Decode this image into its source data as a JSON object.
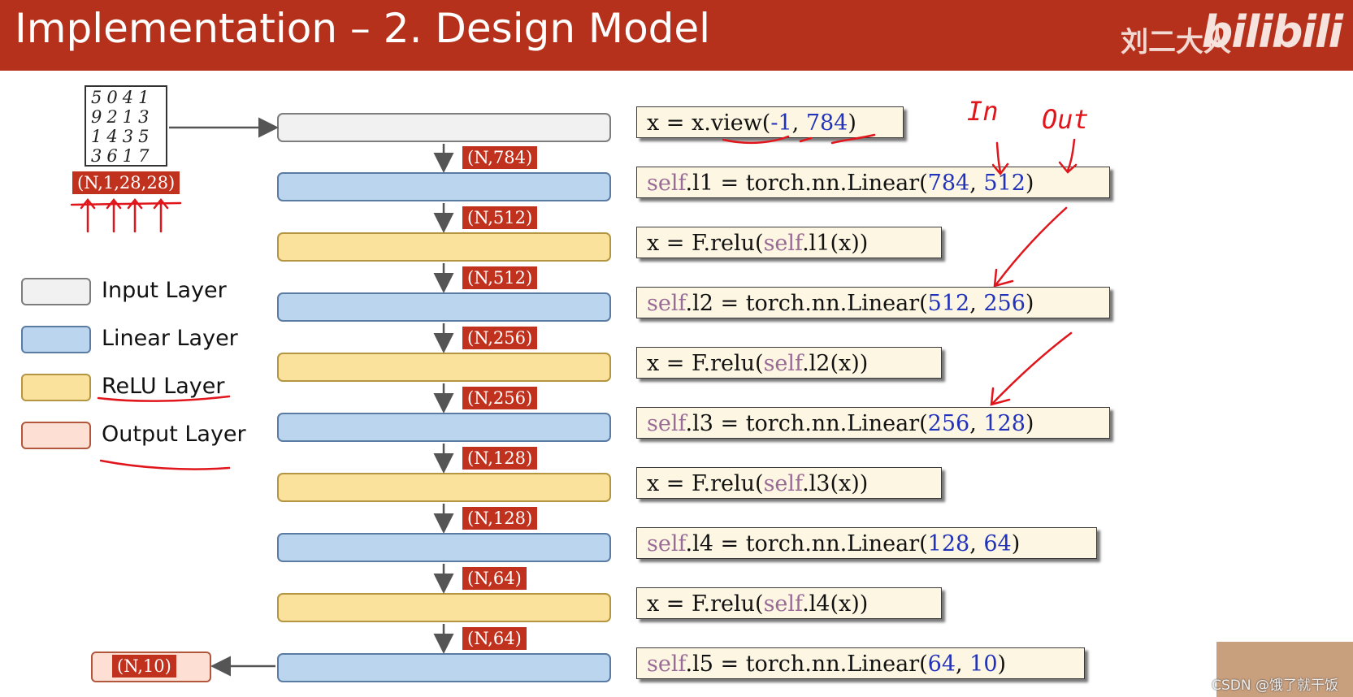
{
  "header": {
    "title": "Implementation – 2. Design Model",
    "brand": "刘二大人",
    "logo": "bilibili"
  },
  "input_image": {
    "digit_rows": [
      "5041",
      "9213",
      "1435",
      "3617"
    ],
    "shape_label": "(N,1,28,28)"
  },
  "legend": {
    "items": [
      {
        "label": "Input Layer",
        "color": "#f1f1f1"
      },
      {
        "label": "Linear Layer",
        "color": "#bcd5ee"
      },
      {
        "label": "ReLU Layer",
        "color": "#fbe29c"
      },
      {
        "label": "Output Layer",
        "color": "#fde0d3"
      }
    ]
  },
  "layers": [
    {
      "type": "input"
    },
    {
      "type": "linear"
    },
    {
      "type": "relu"
    },
    {
      "type": "linear"
    },
    {
      "type": "relu"
    },
    {
      "type": "linear"
    },
    {
      "type": "relu"
    },
    {
      "type": "linear"
    },
    {
      "type": "relu"
    },
    {
      "type": "linear"
    }
  ],
  "shapes": [
    "(N,784)",
    "(N,512)",
    "(N,512)",
    "(N,256)",
    "(N,256)",
    "(N,128)",
    "(N,128)",
    "(N,64)",
    "(N,64)"
  ],
  "output": {
    "label": "(N,10)"
  },
  "code": {
    "c1": {
      "a": "x = x.view(",
      "b": "-1",
      "c": ", ",
      "d": "784",
      "e": ")"
    },
    "c2": {
      "kw": "self",
      "a": ".l1 = torch.nn.Linear(",
      "n1": "784",
      "sep": ", ",
      "n2": "512",
      "end": ")"
    },
    "c3": {
      "a": "x = F.relu(",
      "kw": "self",
      "b": ".l1(x))"
    },
    "c4": {
      "kw": "self",
      "a": ".l2 = torch.nn.Linear(",
      "n1": "512",
      "sep": ", ",
      "n2": "256",
      "end": ")"
    },
    "c5": {
      "a": "x = F.relu(",
      "kw": "self",
      "b": ".l2(x))"
    },
    "c6": {
      "kw": "self",
      "a": ".l3 = torch.nn.Linear(",
      "n1": "256",
      "sep": ", ",
      "n2": "128",
      "end": ")"
    },
    "c7": {
      "a": "x = F.relu(",
      "kw": "self",
      "b": ".l3(x))"
    },
    "c8": {
      "kw": "self",
      "a": ".l4 = torch.nn.Linear(",
      "n1": "128",
      "sep": ", ",
      "n2": "64",
      "end": ")"
    },
    "c9": {
      "a": "x = F.relu(",
      "kw": "self",
      "b": ".l4(x))"
    },
    "c10": {
      "kw": "self",
      "a": ".l5 = torch.nn.Linear(",
      "n1": "64",
      "sep": ", ",
      "n2": "10",
      "end": ")"
    }
  },
  "annotations": {
    "in": "In",
    "out": "Out"
  },
  "watermark": "CSDN @饿了就干饭"
}
